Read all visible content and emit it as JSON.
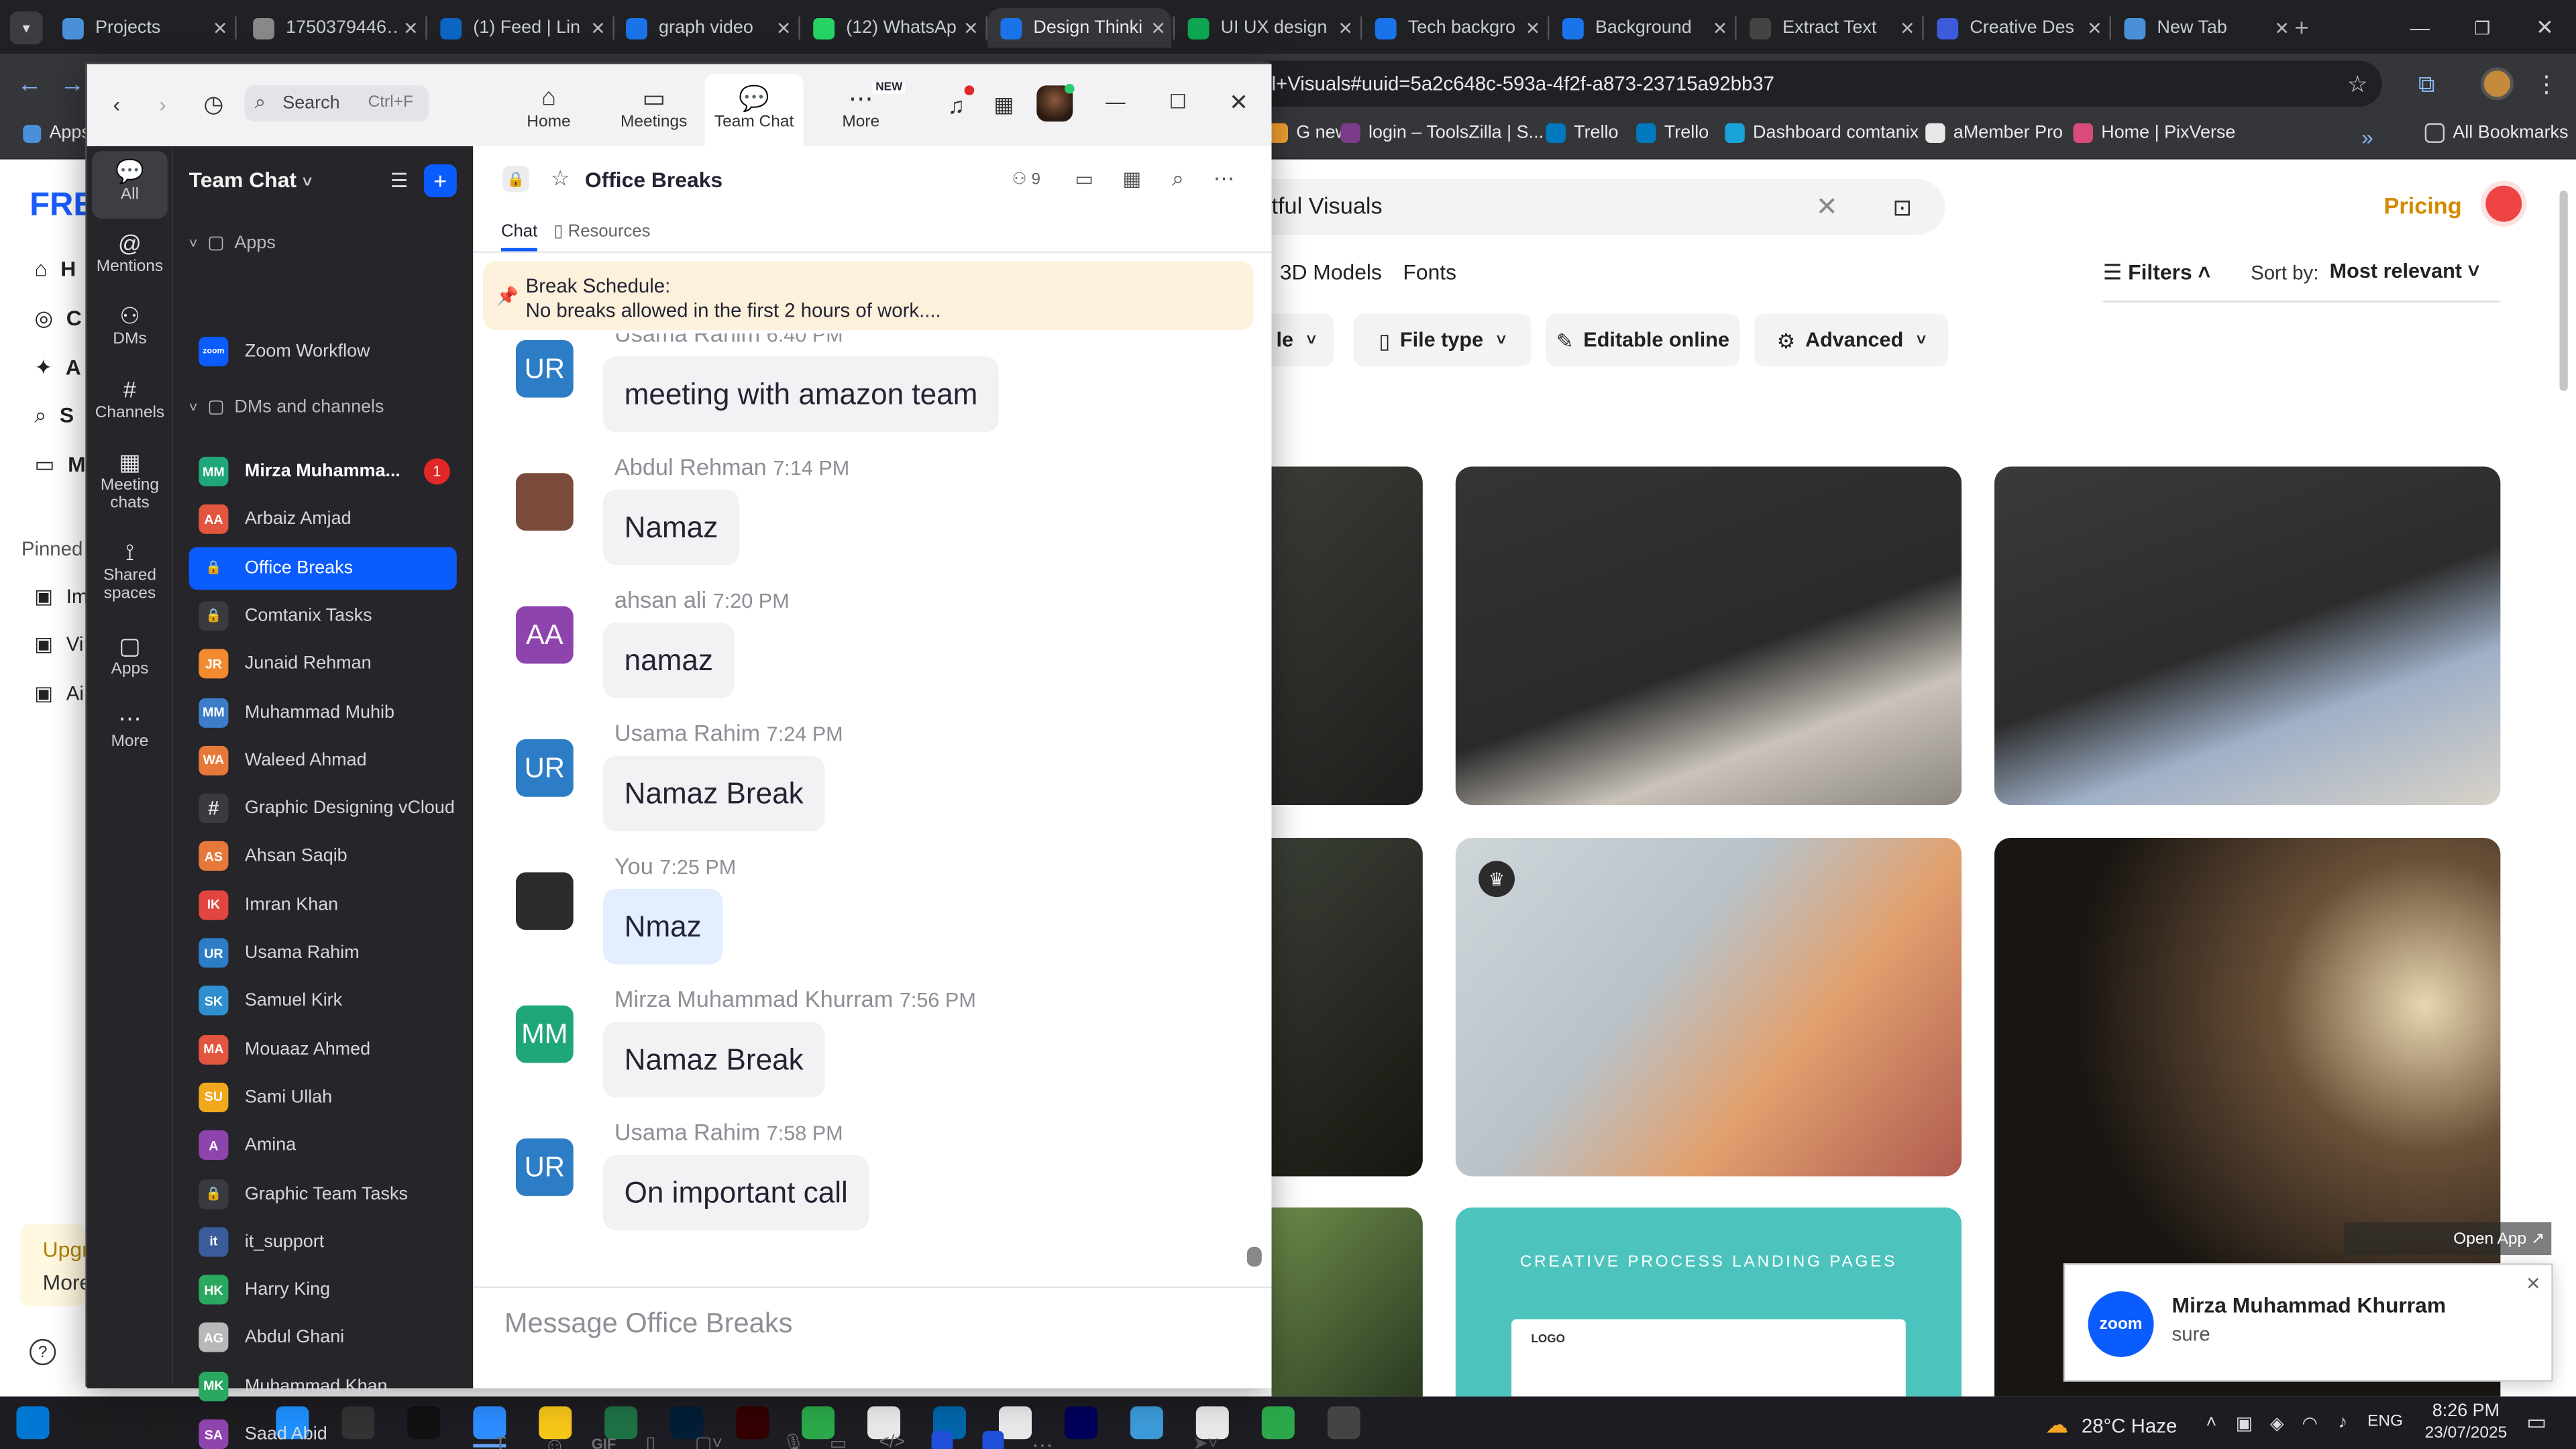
{
  "browser": {
    "tabs": [
      {
        "label": "Projects",
        "color": "#4a90d9"
      },
      {
        "label": "1750379446…",
        "color": "#888888"
      },
      {
        "label": "(1) Feed | Lin",
        "color": "#0a66c2"
      },
      {
        "label": "graph video",
        "color": "#1a73e8"
      },
      {
        "label": "(12) WhatsAp",
        "color": "#25d366"
      },
      {
        "label": "Design Thinki",
        "color": "#1a73e8"
      },
      {
        "label": "UI UX design",
        "color": "#0ea651"
      },
      {
        "label": "Tech backgro",
        "color": "#1a73e8"
      },
      {
        "label": "Background",
        "color": "#1a73e8"
      },
      {
        "label": "Extract Text",
        "color": "#444444"
      },
      {
        "label": "Creative Des",
        "color": "#3b5bdb"
      },
      {
        "label": "New Tab",
        "color": "#4a90d9"
      }
    ],
    "url": "l+Visuals#uuid=5a2c648c-593a-4f2f-a873-23715a92bb37",
    "apps_label": "Apps",
    "bookmarks": [
      "G new",
      "login – ToolsZilla | S...",
      "Trello",
      "Trello",
      "Dashboard comtanix",
      "aMember Pro",
      "Home | PixVerse"
    ],
    "all_bookmarks": "All Bookmarks"
  },
  "web": {
    "logo": "FRE",
    "search_value": "tful Visuals",
    "pricing": "Pricing",
    "nav_links": [
      "3D Models",
      "Fonts"
    ],
    "filters_label": "Filters",
    "sort_label": "Sort by:",
    "sort_value": "Most relevant",
    "filter_buttons": [
      "le",
      "File type",
      "Editable online",
      "Advanced"
    ],
    "side_nav": [
      "H",
      "C",
      "A",
      "S",
      "M"
    ],
    "pinned_label": "Pinned",
    "pinned_items": [
      "Im",
      "Vi",
      "Ai"
    ],
    "upgrade_label": "Upgr",
    "more_label": "More",
    "landing_title": "CREATIVE PROCESS LANDING PAGES",
    "landing_logo": "LOGO",
    "open_app": "Open App ↗"
  },
  "notification": {
    "app": "zoom",
    "name": "Mirza Muhammad Khurram",
    "text": "sure"
  },
  "zoom": {
    "search_placeholder": "Search",
    "search_shortcut": "Ctrl+F",
    "nav": [
      {
        "label": "Home"
      },
      {
        "label": "Meetings"
      },
      {
        "label": "Team Chat"
      },
      {
        "label": "More",
        "badge": "NEW"
      }
    ],
    "rail": [
      "All",
      "Mentions",
      "DMs",
      "Channels",
      "Meeting chats",
      "Shared spaces",
      "Apps",
      "More"
    ],
    "list_title": "Team Chat",
    "apps_section": "Apps",
    "zoom_workflow": "Zoom Workflow",
    "dm_section": "DMs and channels",
    "contacts": [
      {
        "initials": "MM",
        "name": "Mirza Muhamma...",
        "color": "#1fa77a",
        "badge": "1",
        "bold": true
      },
      {
        "initials": "AA",
        "name": "Arbaiz Amjad",
        "color": "#e2553f"
      },
      {
        "initials": "🔒",
        "name": "Office Breaks",
        "color": "#0b5cff",
        "selected": true
      },
      {
        "initials": "🔒",
        "name": "Comtanix Tasks",
        "color": "#3a3b40"
      },
      {
        "initials": "JR",
        "name": "Junaid Rehman",
        "color": "#f28b30"
      },
      {
        "initials": "MM",
        "name": "Muhammad Muhib",
        "color": "#3d7cc9"
      },
      {
        "initials": "WA",
        "name": "Waleed Ahmad",
        "color": "#e6783a"
      },
      {
        "initials": "#",
        "name": "Graphic Designing vCloud",
        "color": "#3a3b40"
      },
      {
        "initials": "AS",
        "name": "Ahsan Saqib",
        "color": "#e6783a"
      },
      {
        "initials": "IK",
        "name": "Imran Khan",
        "color": "#e2453f"
      },
      {
        "initials": "UR",
        "name": "Usama Rahim",
        "color": "#2d7dc6"
      },
      {
        "initials": "SK",
        "name": "Samuel Kirk",
        "color": "#2f8fd0"
      },
      {
        "initials": "MA",
        "name": "Mouaaz Ahmed",
        "color": "#e2553f"
      },
      {
        "initials": "SU",
        "name": "Sami Ullah",
        "color": "#f2a81d"
      },
      {
        "initials": "A",
        "name": "Amina",
        "color": "#8e44ad"
      },
      {
        "initials": "🔒",
        "name": "Graphic Team Tasks",
        "color": "#3a3b40"
      },
      {
        "initials": "it",
        "name": "it_support",
        "color": "#3a5c9a"
      },
      {
        "initials": "HK",
        "name": "Harry King",
        "color": "#2aa860"
      },
      {
        "initials": "AG",
        "name": "Abdul Ghani",
        "color": "#b8b8b8"
      },
      {
        "initials": "MK",
        "name": "Muhammad Khan",
        "color": "#2aa860"
      },
      {
        "initials": "SA",
        "name": "Saad Abid",
        "color": "#8e44ad"
      }
    ],
    "chat_title": "Office Breaks",
    "member_count": "9",
    "tabs": [
      "Chat",
      "Resources"
    ],
    "pinned_title": "Break Schedule:",
    "pinned_text": "No breaks allowed in the first 2 hours of work....",
    "messages": [
      {
        "initials": "UR",
        "color": "#2d7dc6",
        "sender": "Usama Rahim",
        "time": "6:40 PM",
        "text": "meeting with amazon team"
      },
      {
        "initials": "",
        "color": "#7a4b3a",
        "sender": "Abdul Rehman",
        "time": "7:14 PM",
        "text": "Namaz"
      },
      {
        "initials": "AA",
        "color": "#8e44ad",
        "sender": "ahsan ali",
        "time": "7:20 PM",
        "text": "namaz"
      },
      {
        "initials": "UR",
        "color": "#2d7dc6",
        "sender": "Usama Rahim",
        "time": "7:24 PM",
        "text": "Namaz Break"
      },
      {
        "initials": "",
        "color": "#2b2b2b",
        "sender": "You",
        "time": "7:25 PM",
        "text": "Nmaz",
        "mine": true
      },
      {
        "initials": "MM",
        "color": "#1fa77a",
        "sender": "Mirza Muhammad Khurram",
        "time": "7:56 PM",
        "text": "Namaz Break"
      },
      {
        "initials": "UR",
        "color": "#2d7dc6",
        "sender": "Usama Rahim",
        "time": "7:58 PM",
        "text": "On important call"
      }
    ],
    "composer_placeholder": "Message Office Breaks",
    "toolbar": [
      "T",
      "☺",
      "GIF"
    ]
  },
  "taskbar": {
    "weather": "28°C Haze",
    "lang": "ENG",
    "time": "8:26 PM",
    "date": "23/07/2025"
  }
}
